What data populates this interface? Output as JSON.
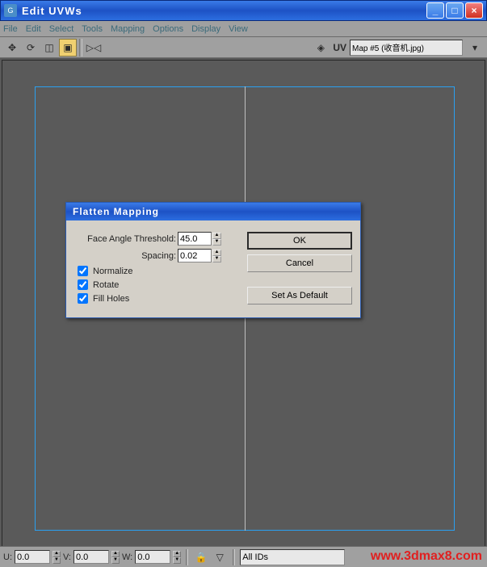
{
  "window": {
    "title": "Edit UVWs"
  },
  "menu": {
    "file": "File",
    "edit": "Edit",
    "select": "Select",
    "tools": "Tools",
    "mapping": "Mapping",
    "options": "Options",
    "display": "Display",
    "view": "View"
  },
  "toolbar": {
    "uv_label": "UV",
    "texture_selected": "Map #5 (收音机.jpg)"
  },
  "dialog": {
    "title": "Flatten Mapping",
    "face_angle_label": "Face Angle Threshold:",
    "face_angle_value": "45.0",
    "spacing_label": "Spacing:",
    "spacing_value": "0.02",
    "normalize_label": "Normalize",
    "rotate_label": "Rotate",
    "fillholes_label": "Fill Holes",
    "ok_label": "OK",
    "cancel_label": "Cancel",
    "default_label": "Set As Default"
  },
  "status": {
    "u_label": "U:",
    "u_value": "0.0",
    "v_label": "V:",
    "v_value": "0.0",
    "w_label": "W:",
    "w_value": "0.0",
    "ids_selected": "All IDs"
  },
  "watermark": "www.3dmax8.com"
}
